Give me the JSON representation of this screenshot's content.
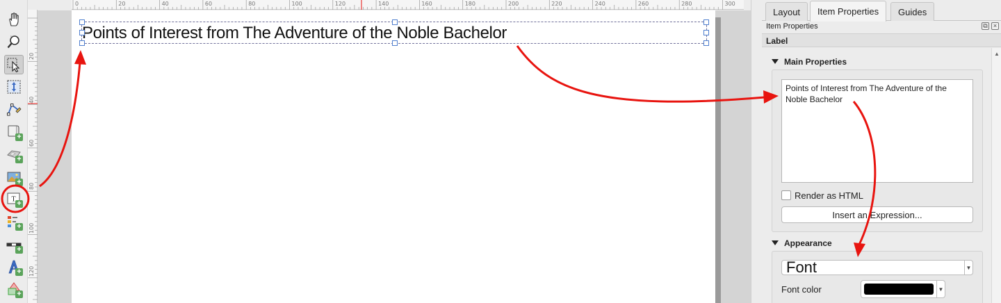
{
  "ruler": {
    "top_labels": [
      "0",
      "20",
      "40",
      "60",
      "80",
      "100",
      "120",
      "140",
      "160",
      "180",
      "200",
      "220",
      "240",
      "260",
      "280",
      "300"
    ],
    "left_labels": [
      "20",
      "40",
      "60",
      "80",
      "100",
      "120"
    ]
  },
  "toolbar": {
    "tools": [
      {
        "name": "pan-icon"
      },
      {
        "name": "zoom-icon"
      },
      {
        "name": "select-move-item-icon"
      },
      {
        "name": "move-content-icon"
      },
      {
        "name": "edit-nodes-icon"
      },
      {
        "name": "add-map-icon"
      },
      {
        "name": "add-3d-map-icon"
      },
      {
        "name": "add-picture-icon"
      },
      {
        "name": "add-label-icon"
      },
      {
        "name": "add-legend-icon"
      },
      {
        "name": "add-scalebar-icon"
      },
      {
        "name": "add-north-arrow-icon"
      },
      {
        "name": "add-shape-icon"
      }
    ]
  },
  "canvas": {
    "label_text": "Points of Interest from The Adventure of the Noble Bachelor"
  },
  "panel": {
    "tabs": [
      {
        "label": "Layout"
      },
      {
        "label": "Item Properties"
      },
      {
        "label": "Guides"
      }
    ],
    "dock_title": "Item Properties",
    "header": "Label",
    "main_properties": {
      "heading": "Main Properties",
      "text": "Points of Interest from The Adventure of the Noble Bachelor",
      "render_html_label": "Render as HTML",
      "render_html_checked": false,
      "insert_expression_label": "Insert an Expression..."
    },
    "appearance": {
      "heading": "Appearance",
      "font_label": "Font",
      "font_color_label": "Font color",
      "font_color": "#000000"
    }
  },
  "colors": {
    "annotation": "#e8140f",
    "selection": "#4f7fcf"
  }
}
